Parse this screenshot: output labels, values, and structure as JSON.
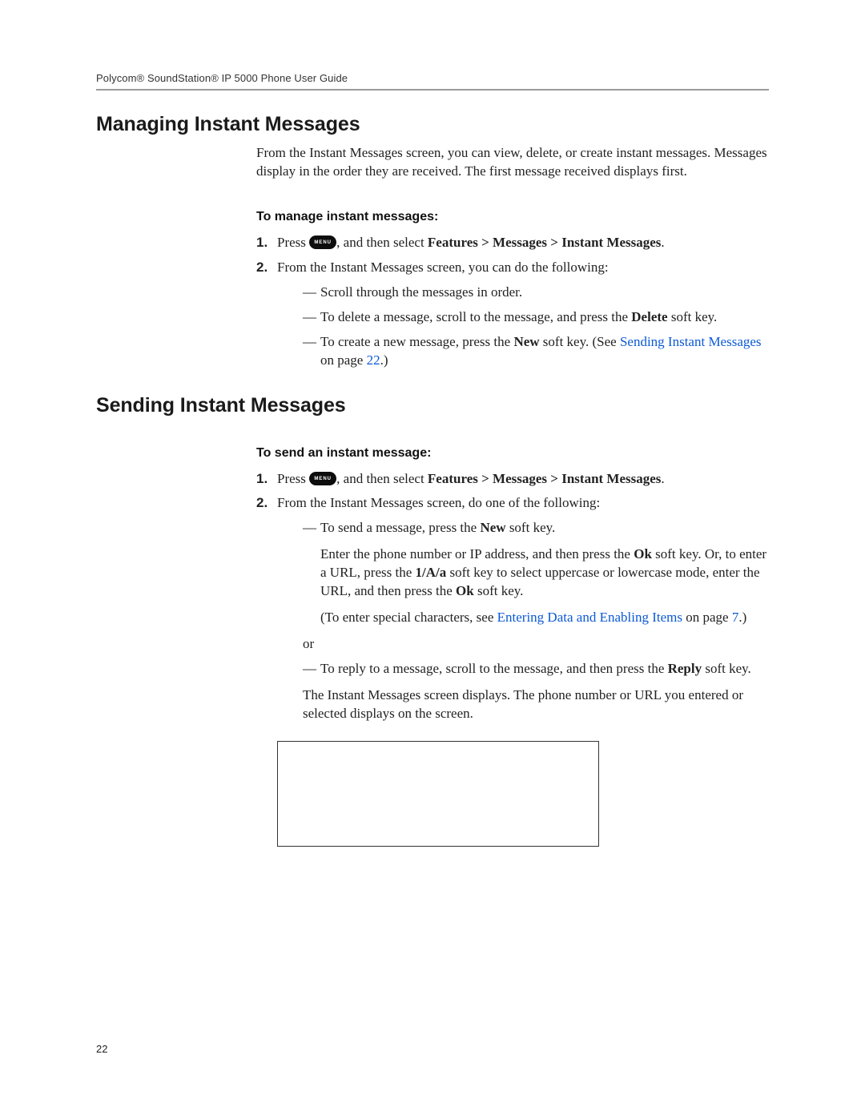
{
  "header": {
    "running_head": "Polycom® SoundStation® IP 5000 Phone User Guide"
  },
  "section1": {
    "title": "Managing Instant Messages",
    "intro": "From the Instant Messages screen, you can view, delete, or create instant messages. Messages display in the order they are received. The first message received displays first.",
    "subhead": "To manage instant messages:",
    "step1_pre": "Press ",
    "menu_key_label": "MENU",
    "step1_mid": ", and then select ",
    "step1_bold": "Features > Messages > Instant Messages",
    "step1_post": ".",
    "step2": "From the Instant Messages screen, you can do the following:",
    "bullet1": "Scroll through the messages in order.",
    "bullet2_pre": "To delete a message, scroll to the message, and press the ",
    "bullet2_bold": "Delete",
    "bullet2_post": " soft key.",
    "bullet3_pre": "To create a new message, press the ",
    "bullet3_bold": "New",
    "bullet3_mid": " soft key. (See ",
    "bullet3_link": "Sending Instant Messages",
    "bullet3_post1": " on page ",
    "bullet3_link_pg": "22",
    "bullet3_post2": ".)"
  },
  "section2": {
    "title": "Sending Instant Messages",
    "subhead": "To send an instant message:",
    "step1_pre": "Press ",
    "menu_key_label": "MENU",
    "step1_mid": ", and then select ",
    "step1_bold": "Features > Messages > Instant Messages",
    "step1_post": ".",
    "step2": "From the Instant Messages screen, do one of the following:",
    "b1_pre": "To send a message, press the ",
    "b1_bold": "New",
    "b1_post": " soft key.",
    "b1_para2_a": "Enter the phone number or IP address, and then press the ",
    "b1_para2_ok1": "Ok",
    "b1_para2_b": " soft key. Or, to enter a URL, press the ",
    "b1_para2_1Aa": "1/A/a",
    "b1_para2_c": " soft key to select uppercase or lowercase mode, enter the URL, and then press the ",
    "b1_para2_ok2": "Ok",
    "b1_para2_d": " soft key.",
    "b1_para3_a": "(To enter special characters, see ",
    "b1_para3_link": "Entering Data and Enabling Items",
    "b1_para3_b": " on page ",
    "b1_para3_pg": "7",
    "b1_para3_c": ".)",
    "or_text": "or",
    "b2_pre": "To reply to a message, scroll to the message, and then press the ",
    "b2_bold": "Reply",
    "b2_post": " soft key.",
    "trail": "The Instant Messages screen displays. The phone number or URL you entered or selected displays on the screen."
  },
  "page_number": "22"
}
